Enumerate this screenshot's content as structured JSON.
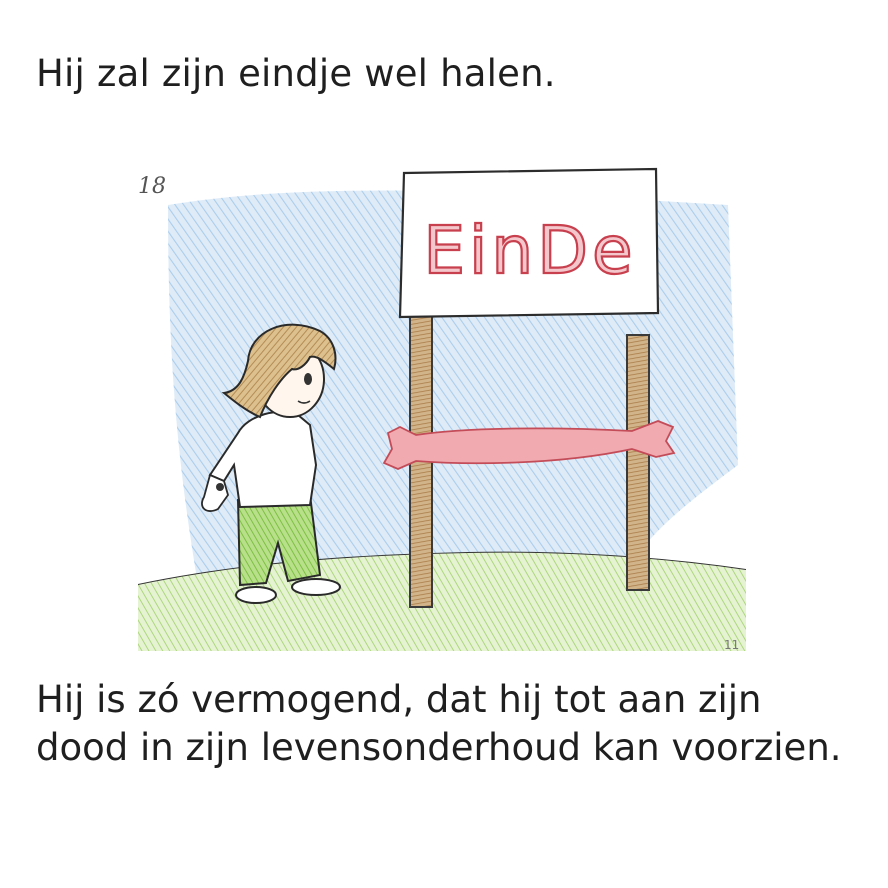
{
  "top_text": "Hij zal zijn eindje wel halen.",
  "illustration": {
    "page_number": "18",
    "sign_text": "EinDe",
    "corner_mark": "11",
    "colors": {
      "sky": "#9cc4e8",
      "ground": "#a8d87a",
      "ribbon": "#e0707a",
      "post": "#b89060",
      "hair": "#c9a36b",
      "pants": "#8cc850",
      "sign_text": "#d05a68"
    }
  },
  "bottom_text": "Hij is zó vermogend, dat hij tot aan zijn dood in zijn levensonderhoud kan voorzien."
}
